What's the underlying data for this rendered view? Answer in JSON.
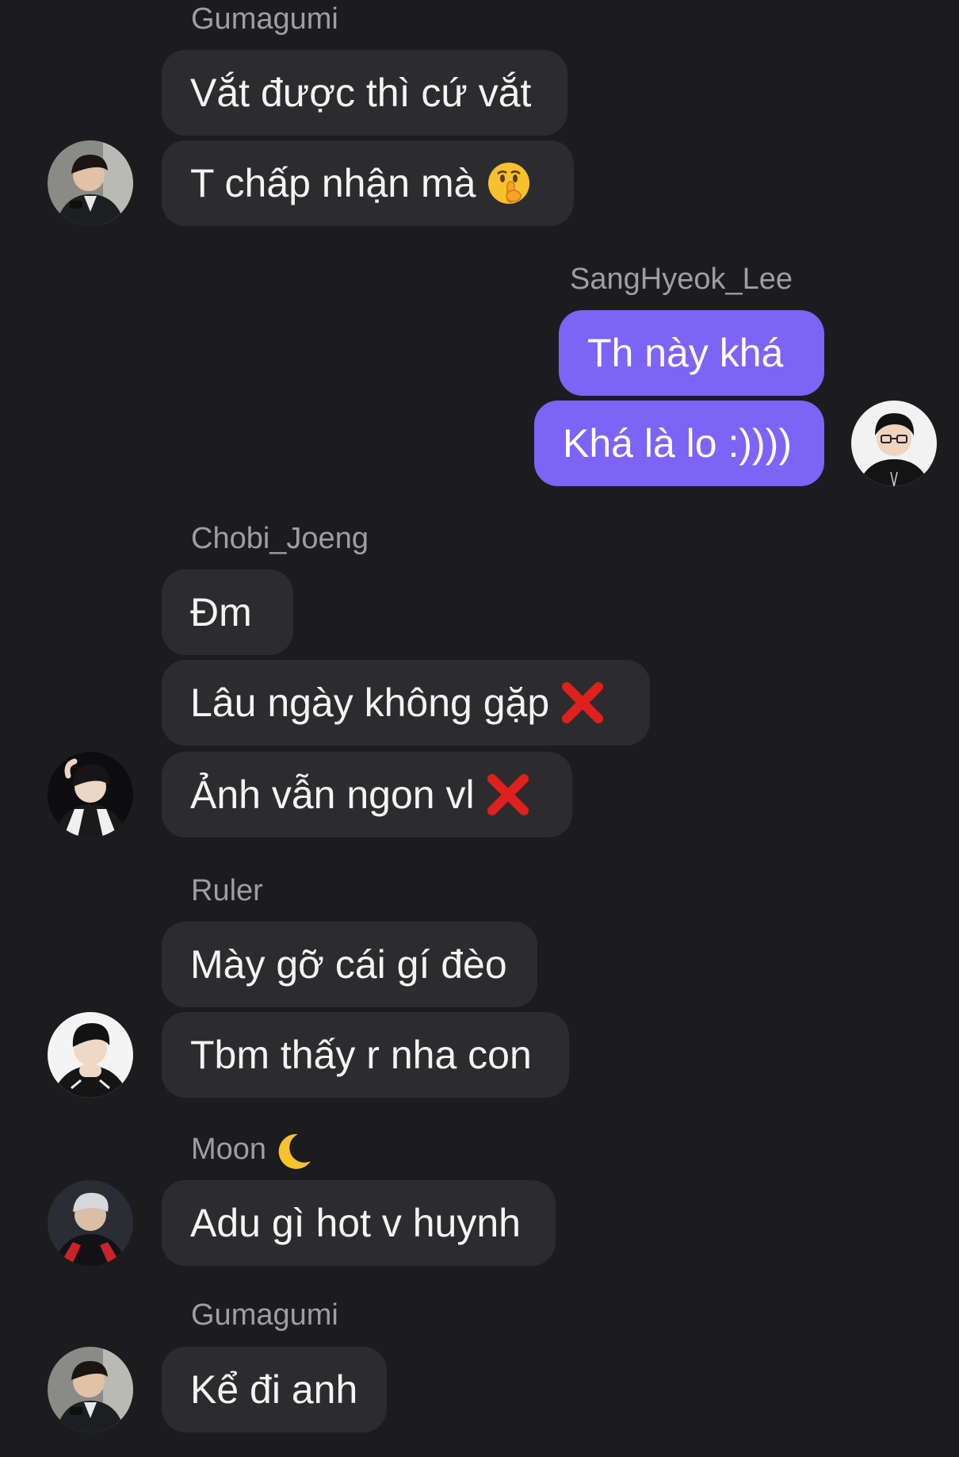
{
  "messages": [
    {
      "sender": "Gumagumi",
      "lines": [
        "Vắt được thì cứ vắt",
        "T chấp nhận mà"
      ],
      "line2_emoji": "shushing-face-icon"
    },
    {
      "sender": "SangHyeok_Lee",
      "lines": [
        "Th này khá",
        "Khá là lo :))))"
      ]
    },
    {
      "sender": "Chobi_Joeng",
      "lines": [
        "Đm",
        "Lâu ngày không gặp",
        "Ảnh vẫn ngon vl"
      ],
      "emoji": "cross-mark-icon"
    },
    {
      "sender": "Ruler",
      "lines": [
        "Mày gỡ cái gí đèo",
        "Tbm thấy r nha con"
      ]
    },
    {
      "sender": "Moon",
      "sender_emoji": "crescent-moon-icon",
      "lines": [
        "Adu gì hot v huynh"
      ]
    },
    {
      "sender": "Gumagumi",
      "lines": [
        "Kể đi anh"
      ]
    }
  ],
  "colors": {
    "background": "#1c1c1e",
    "incoming_bubble": "#2c2c2e",
    "outgoing_bubble": "#7c64f7",
    "sender_name": "#9e9ea3"
  }
}
